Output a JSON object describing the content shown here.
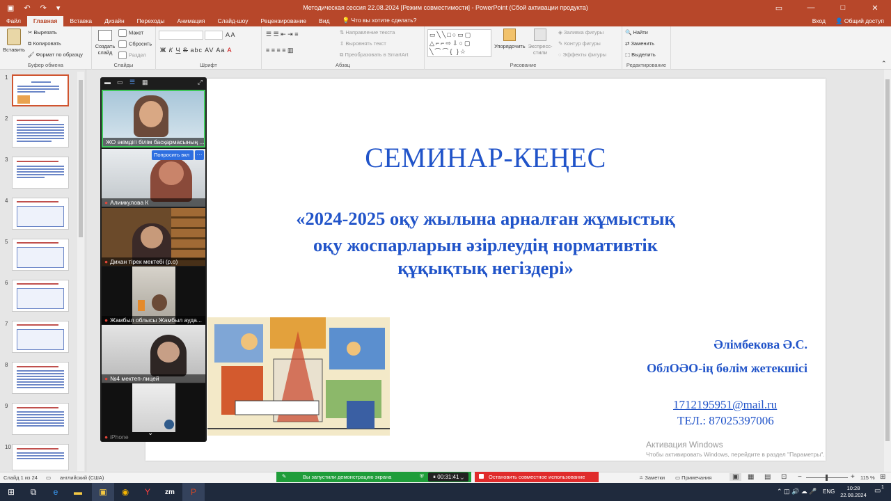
{
  "window": {
    "title": "Методическая сессия 22.08.2024 [Режим совместимости] - PowerPoint (Сбой активации продукта)",
    "quick_save_icon": "save-icon",
    "undo_icon": "undo-icon",
    "redo_icon": "redo-icon",
    "minimize": "—",
    "maximize": "□",
    "close": "✕",
    "restore": "▭"
  },
  "tabs": [
    "Файл",
    "Главная",
    "Вставка",
    "Дизайн",
    "Переходы",
    "Анимация",
    "Слайд-шоу",
    "Рецензирование",
    "Вид"
  ],
  "tell_me": "Что вы хотите сделать?",
  "signin": "Вход",
  "share": "Общий доступ",
  "ribbon": {
    "clipboard": {
      "paste": "Вставить",
      "cut": "Вырезать",
      "copy": "Копировать",
      "format_painter": "Формат по образцу",
      "label": "Буфер обмена"
    },
    "slides": {
      "new_slide_1": "Создать",
      "new_slide_2": "слайд",
      "layout": "Макет",
      "reset": "Сбросить",
      "section": "Раздел",
      "label": "Слайды"
    },
    "font": {
      "label": "Шрифт",
      "bold": "Ж",
      "italic": "К",
      "underline": "Ч",
      "strike": "S",
      "shadow": "abc",
      "spacing": "AV",
      "case": "Aa"
    },
    "paragraph": {
      "text_direction": "Направление текста",
      "align_text": "Выровнять текст",
      "smartart": "Преобразовать в SmartArt",
      "label": "Абзац"
    },
    "drawing": {
      "arrange": "Упорядочить",
      "quick_styles_1": "Экспресс-",
      "quick_styles_2": "стили",
      "fill": "Заливка фигуры",
      "outline": "Контур фигуры",
      "effects": "Эффекты фигуры",
      "label": "Рисование",
      "shapes_preview": "▭╲╲□○▭▢ △⌐⌐⇨⇩○▢ ╲⌒⌒{ }☆"
    },
    "editing": {
      "find": "Найти",
      "replace": "Заменить",
      "select": "Выделить",
      "label": "Редактирование"
    }
  },
  "slides_pane": {
    "numbers": [
      "1",
      "2",
      "3",
      "4",
      "5",
      "6",
      "7",
      "8",
      "9",
      "10"
    ]
  },
  "slide": {
    "title": "СЕМИНАР-КЕҢЕС",
    "subtitle_lines": [
      "«2024-2025 оқу жылына арналған жұмыстық",
      "оқу жоспарларын әзірлеудің нормативтік",
      "құқықтық негіздері»"
    ],
    "author": "Әлімбекова Ә.С.",
    "position": "ОблОӘО-ің бөлім жетекшісі",
    "email": "1712195951@mail.ru",
    "phone": "ТЕЛ.: 87025397006"
  },
  "zoom": {
    "participants": [
      {
        "name": "ЖО әкімдігі білім басқармасының ..."
      },
      {
        "name": "Алимкулова К"
      },
      {
        "name": "Дихан тірек мектебі (р.о)"
      },
      {
        "name": "Жамбыл облысы Жамбыл ауда..."
      },
      {
        "name": "№4 мектеп-лицей"
      },
      {
        "name": "iPhone"
      }
    ],
    "ask_button": "Попросить вкл",
    "more_button": "···",
    "scroll_down_icon": "chevron-down-icon"
  },
  "activation": {
    "title": "Активация Windows",
    "text": "Чтобы активировать Windows, перейдите в раздел \"Параметры\"."
  },
  "status": {
    "slide": "Слайд 1 из 24",
    "lang": "английский (США)",
    "notes": "Заметки",
    "comments": "Примечания",
    "zoom_level": "115 %"
  },
  "share_bar": {
    "text": "Вы запустили демонстрацию экрана",
    "timer": "00:31:41",
    "stop": "Остановить совместное использование"
  },
  "taskbar": {
    "lang": "ENG",
    "time": "10:28",
    "date": "22.08.2024",
    "notification_count": "1",
    "zoom_app": "zm"
  }
}
